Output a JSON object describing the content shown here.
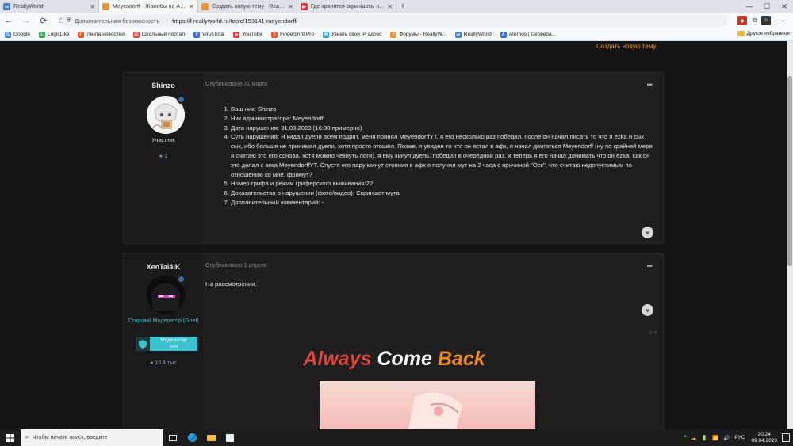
{
  "browser": {
    "tabs": [
      {
        "label": "ReallyWorld",
        "icon_color": "#4680c2",
        "icon_text": "VK",
        "active": false
      },
      {
        "label": "Meyendorff - Жалобы на Адми...",
        "icon_color": "#e8963c",
        "icon_text": "",
        "active": true
      },
      {
        "label": "Создать новую тему - ReallyW...",
        "icon_color": "#e8963c",
        "icon_text": "",
        "active": false
      },
      {
        "label": "Где хранятся скриншоты на ко...",
        "icon_color": "#e53935",
        "icon_text": "▶",
        "active": false
      }
    ],
    "new_tab": "+",
    "window_controls": {
      "minimize": "—",
      "maximize": "☐",
      "close": "✕"
    },
    "nav": {
      "back": "←",
      "forward": "→",
      "reload": "⟳",
      "home": "⌂"
    },
    "address": {
      "security_label": "Дополнительная безопасность",
      "url": "https://f.reallyworld.ru/topic/153141-meyendorff/"
    },
    "bookmarks": [
      {
        "label": "Google",
        "icon": "google-icon",
        "color": "#4285f4",
        "icon_text": "G"
      },
      {
        "label": "LogicLike",
        "icon": "logiclike-icon",
        "color": "#3aa655",
        "icon_text": "L"
      },
      {
        "label": "Лента новостей",
        "icon": "feed-icon",
        "color": "#e05a2b",
        "icon_text": "Л"
      },
      {
        "label": "Школьный портал",
        "icon": "school-icon",
        "color": "#d84a38",
        "icon_text": "Ш"
      },
      {
        "label": "VirusTotal",
        "icon": "virustotal-icon",
        "color": "#3a6fd8",
        "icon_text": "V"
      },
      {
        "label": "YouTube",
        "icon": "youtube-icon",
        "color": "#e53935",
        "icon_text": "▶"
      },
      {
        "label": "Fingerprint Pro",
        "icon": "fingerprint-icon",
        "color": "#e8562b",
        "icon_text": "F"
      },
      {
        "label": "Узнать свой IP адрес",
        "icon": "ip-icon",
        "color": "#2aa3c9",
        "icon_text": "W"
      },
      {
        "label": "Форумы - ReallyW...",
        "icon": "forum-icon",
        "color": "#e8963c",
        "icon_text": "F"
      },
      {
        "label": "ReallyWorld",
        "icon": "vk-icon",
        "color": "#4680c2",
        "icon_text": "VK"
      },
      {
        "label": "Aternos | Сервера...",
        "icon": "aternos-icon",
        "color": "#3a6fd8",
        "icon_text": "A"
      }
    ],
    "other_bookmarks": "Другое избранное"
  },
  "page": {
    "create_topic": "Создать новую тему",
    "posts": [
      {
        "author": "Shinzo",
        "role": "Участник",
        "post_count": "1",
        "published": "Опубликовано 31 марта",
        "items": [
          "Ваш ник: Shinzo",
          "Ник администратора: Meyendorff",
          "Дата нарушения: 31.03.2023 (16:30 примерно)",
          "Суть нарушения: Я кидал дуели всем подрят, меня принял MeyendorffYT, я его несколько раз победил, после он начал писать то что я ezka и сык сык, ибо больше не принимал дуели, хотя просто отошёл. Позже, я увидел то что он встал в афк, и начал двигаться Meyendorff (ну по крайней мере я считаю это его основа, хотя можно чекнуть логи), я ему кинул дуель, победил в очередной раз, и теперь я его начал донимать что он ezka, как он это делал с акка MeyendorffYT. Спустя его пару минут стояния в афк я получил мут на 2 часа с причиной \"Оск\", что считаю недопустимым по отношению ко мне, фримут?",
          "Номер грифа и режим гриферского выживания:22",
          "Доказательства о нарушении (фото/видео): ",
          "Дополнительный комментарий: -"
        ],
        "evidence_link": "Скриншот мута"
      },
      {
        "author": "XenTai4IK",
        "role": "Старший Модератор (Grief)",
        "post_count": "10.4 тыс",
        "published": "Опубликовано 1 апреля",
        "text": "На рассмотрении.",
        "badge": {
          "title": "Модератор",
          "subtitle": "Grief"
        },
        "signature": {
          "word1": "Always",
          "word2": "Come",
          "word3": "Back"
        }
      }
    ]
  },
  "taskbar": {
    "search_placeholder": "Чтобы начать поиск, введите",
    "language": "РУС",
    "time": "20:24",
    "date": "09.04.2023",
    "tray_icons": [
      "^",
      "☁",
      "🔋",
      "📶",
      "🔊"
    ]
  },
  "colors": {
    "accent": "#e8963c",
    "moderator": "#3ac2cf"
  }
}
